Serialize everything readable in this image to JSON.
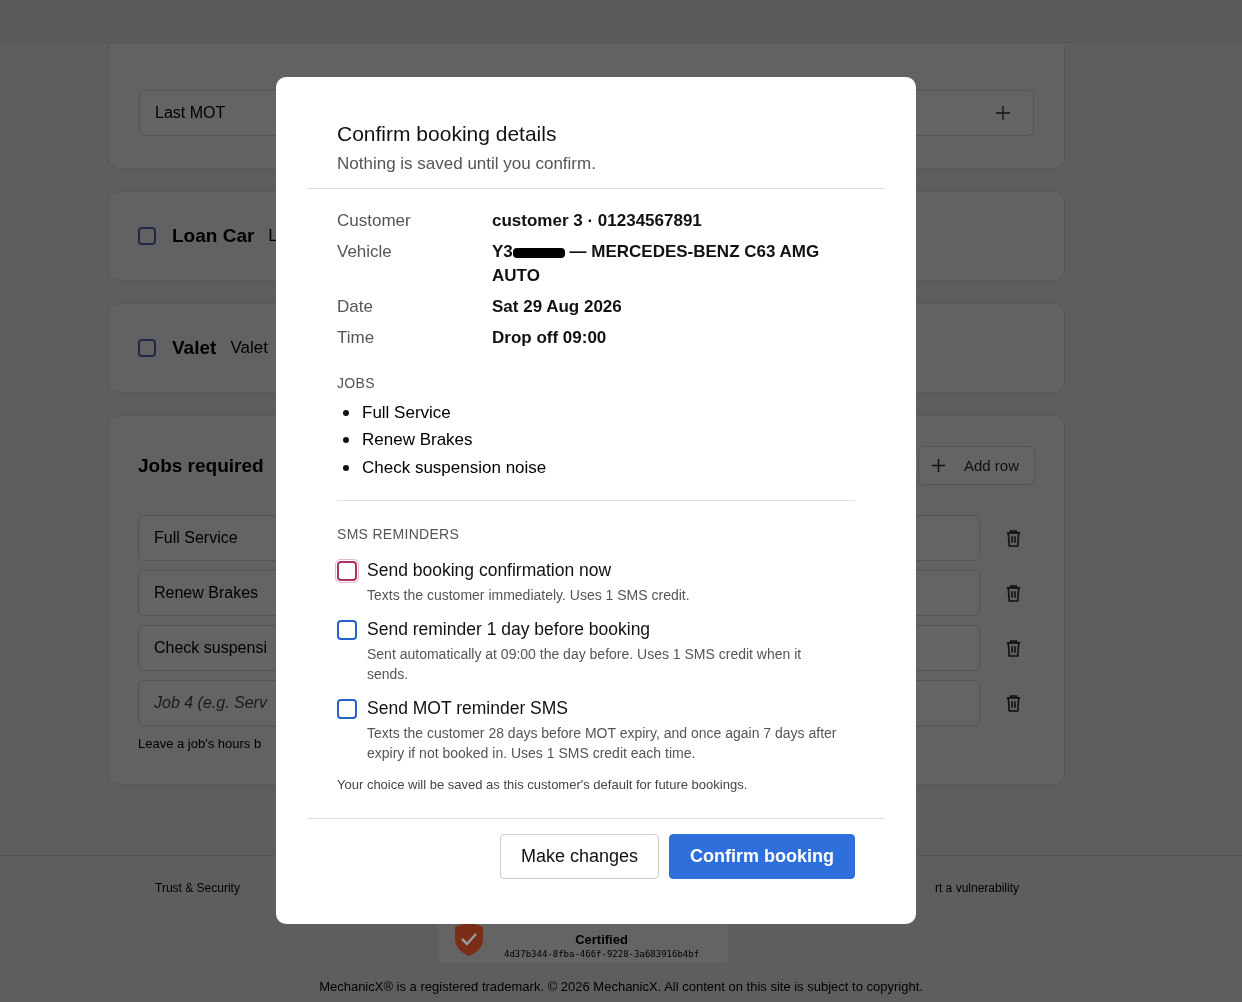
{
  "background": {
    "last_mot": {
      "label": "Last MOT"
    },
    "options": [
      {
        "label": "Loan Car",
        "description": "L",
        "checked": false
      },
      {
        "label": "Valet",
        "description": "Valet",
        "checked": false
      }
    ],
    "jobs": {
      "title": "Jobs required",
      "add_button": "Add row",
      "rows": [
        {
          "value": "Full Service",
          "placeholder": false
        },
        {
          "value": "Renew Brakes",
          "placeholder": false
        },
        {
          "value": "Check suspensi",
          "placeholder": false
        },
        {
          "value": "Job 4 (e.g. Serv",
          "placeholder": true
        }
      ],
      "hint": "Leave a job's hours b"
    },
    "footer": {
      "links": [
        "Trust & Security",
        "rt a vulnerability"
      ],
      "badge": {
        "label": "Certified",
        "code": "4d37b344-8fba-466f-9228-3a683916b4bf"
      },
      "copyright": "MechanicX® is a registered trademark. © 2026 MechanicX. All content on this site is subject to copyright."
    }
  },
  "dialog": {
    "title": "Confirm booking details",
    "subtitle": "Nothing is saved until you confirm.",
    "details": [
      {
        "label": "Customer",
        "value": "customer 3 · 01234567891"
      },
      {
        "label": "Vehicle",
        "value": "Y3",
        "redacted": true,
        "rest": "— MERCEDES-BENZ C63 AMG AUTO"
      },
      {
        "label": "Date",
        "value": "Sat 29 Aug 2026"
      },
      {
        "label": "Time",
        "value": "Drop off 09:00"
      }
    ],
    "jobs_heading": "JOBS",
    "jobs": [
      "Full Service",
      "Renew Brakes",
      "Check suspension noise"
    ],
    "sms_heading": "SMS REMINDERS",
    "reminders": [
      {
        "title": "Send booking confirmation now",
        "description": "Texts the customer immediately. Uses 1 SMS credit.",
        "checked": false,
        "focused": true
      },
      {
        "title": "Send reminder 1 day before booking",
        "description": "Sent automatically at 09:00 the day before. Uses 1 SMS credit when it sends.",
        "checked": false,
        "focused": false
      },
      {
        "title": "Send MOT reminder SMS",
        "description": "Texts the customer 28 days before MOT expiry, and once again 7 days after expiry if not booked in. Uses 1 SMS credit each time.",
        "checked": false,
        "focused": false
      }
    ],
    "note": "Your choice will be saved as this customer's default for future bookings.",
    "buttons": [
      {
        "label": "Make changes",
        "kind": "secondary"
      },
      {
        "label": "Confirm booking",
        "kind": "primary"
      }
    ]
  }
}
